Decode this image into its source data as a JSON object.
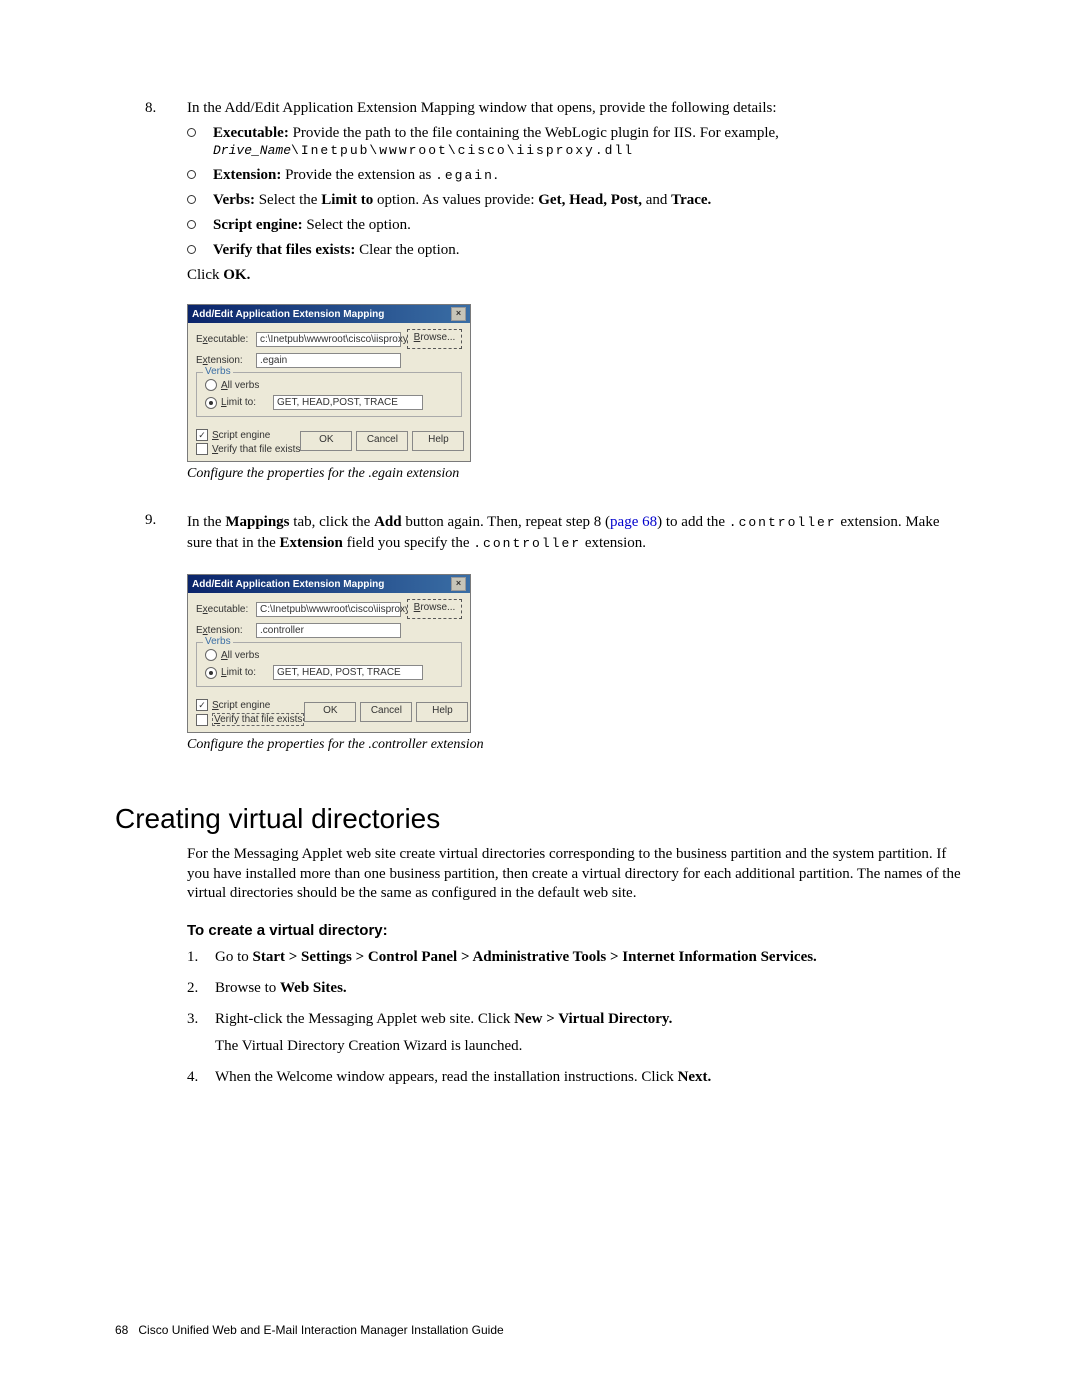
{
  "step8": {
    "num": "8.",
    "intro": "In the Add/Edit Application Extension Mapping window that opens, provide the following details:",
    "bullets": {
      "exec_label": "Executable:",
      "exec_text": " Provide the path to the file containing the WebLogic plugin for IIS. For example, ",
      "exec_drive": "Drive_Name",
      "exec_path": "\\Inetpub\\wwwroot\\cisco\\iisproxy.dll",
      "ext_label": "Extension:",
      "ext_text": " Provide the extension as ",
      "ext_val": ".egain",
      "ext_end": ".",
      "verbs_label": "Verbs:",
      "verbs_text1": " Select the ",
      "verbs_limit": "Limit to",
      "verbs_text2": " option. As values provide: ",
      "verbs_vals": "Get, Head, Post,",
      "verbs_text3": " and ",
      "verbs_trace": "Trace.",
      "script_label": "Script engine:",
      "script_text": " Select the option.",
      "verify_label": "Verify that files exists:",
      "verify_text": " Clear the option."
    },
    "click_prefix": "Click ",
    "click_ok": "OK."
  },
  "dialog1": {
    "title": "Add/Edit Application Extension Mapping",
    "executable_label_pre": "E",
    "executable_label_u": "x",
    "executable_label_post": "ecutable:",
    "executable_value": "c:\\Inetpub\\wwwroot\\cisco\\iisproxy.dll",
    "browse_u": "B",
    "browse_rest": "rowse...",
    "extension_label_pre": "E",
    "extension_label_u": "x",
    "extension_label_post": "tension:",
    "extension_value": ".egain",
    "verbs_legend": "Verbs",
    "all_verbs_u": "A",
    "all_verbs_rest": "ll verbs",
    "limit_u": "L",
    "limit_rest": "imit to:",
    "limit_value": "GET, HEAD,POST, TRACE",
    "script_u": "S",
    "script_rest": "cript engine",
    "verify_u": "V",
    "verify_rest": "erify that file exists",
    "ok": "OK",
    "cancel": "Cancel",
    "help": "Help",
    "caption": "Configure the properties for the .egain extension"
  },
  "step9": {
    "num": "9.",
    "text1": "In the ",
    "mappings": "Mappings",
    "text2": " tab, click the ",
    "add": "Add",
    "text3": " button again. Then, repeat step 8 (",
    "page_link": "page 68",
    "text4": ") to add the ",
    "controller1": ".controller",
    "text5": " extension. Make sure that in the ",
    "extension_bold": "Extension",
    "text6": " field you specify the ",
    "controller2": ".controller",
    "text7": " extension."
  },
  "dialog2": {
    "title": "Add/Edit Application Extension Mapping",
    "executable_value": "C:\\Inetpub\\wwwroot\\cisco\\iisproxy.dll",
    "extension_value": ".controller",
    "limit_value": "GET, HEAD, POST, TRACE",
    "caption": "Configure the properties for the .controller extension"
  },
  "section": {
    "title": "Creating virtual directories",
    "para": "For the Messaging Applet web site create virtual directories corresponding to the business partition and the system partition. If you have installed more than one business partition, then create a virtual directory for each additional partition. The names of the virtual directories should be the same as configured in the default web site.",
    "sub_heading": "To create a virtual directory:",
    "steps": {
      "s1n": "1.",
      "s1_pre": "Go to ",
      "s1_bold": "Start > Settings > Control Panel > Administrative Tools > Internet Information Services.",
      "s2n": "2.",
      "s2_pre": "Browse to ",
      "s2_bold": "Web Sites.",
      "s3n": "3.",
      "s3_pre": "Right-click the Messaging Applet web site. Click ",
      "s3_bold": "New > Virtual Directory.",
      "s3_line2": "The Virtual Directory Creation Wizard is launched.",
      "s4n": "4.",
      "s4_pre": "When the Welcome window appears, read the installation instructions. Click ",
      "s4_bold": "Next."
    }
  },
  "footer": {
    "page_num": "68",
    "title": "Cisco Unified Web and E-Mail Interaction Manager Installation Guide"
  }
}
